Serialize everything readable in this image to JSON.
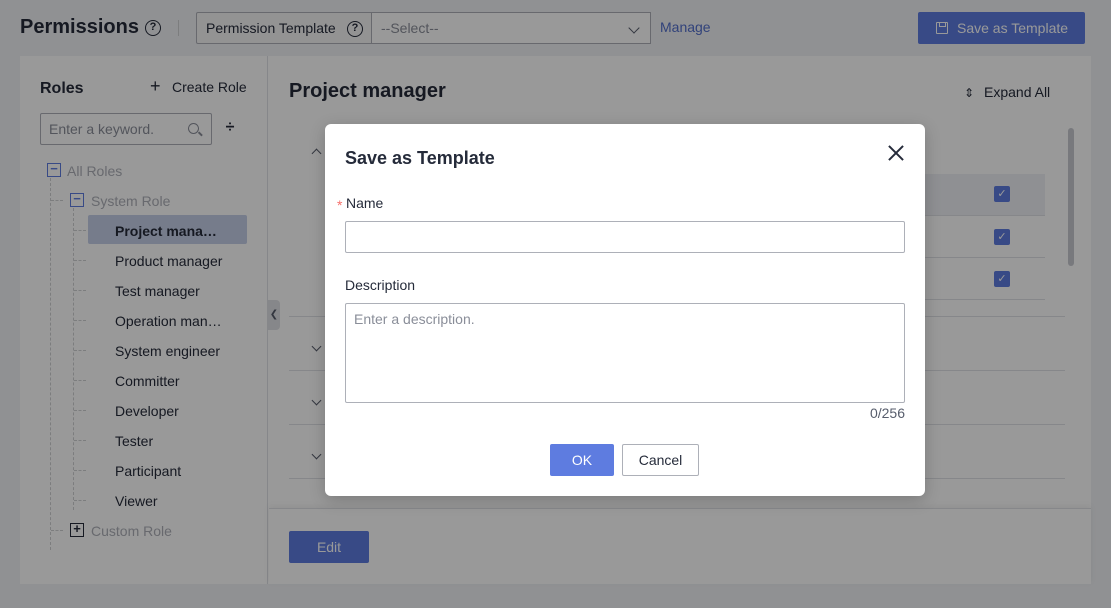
{
  "header": {
    "title": "Permissions",
    "template_label": "Permission Template",
    "template_select": "--Select--",
    "manage_link": "Manage",
    "save_template_button": "Save as Template"
  },
  "sidebar": {
    "title": "Roles",
    "create_role": "Create Role",
    "search_placeholder": "Enter a keyword.",
    "tree": {
      "all_roles": "All Roles",
      "system_role": "System Role",
      "custom_role": "Custom Role",
      "items": [
        {
          "label": "Project mana…",
          "active": true
        },
        {
          "label": "Product manager"
        },
        {
          "label": "Test manager"
        },
        {
          "label": "Operation man…"
        },
        {
          "label": "System engineer"
        },
        {
          "label": "Committer"
        },
        {
          "label": "Developer"
        },
        {
          "label": "Tester"
        },
        {
          "label": "Participant"
        },
        {
          "label": "Viewer"
        }
      ]
    }
  },
  "main": {
    "title": "Project manager",
    "expand_all": "Expand All",
    "edit_button": "Edit"
  },
  "dialog": {
    "title": "Save as Template",
    "name_label": "Name",
    "name_value": "",
    "description_label": "Description",
    "description_placeholder": "Enter a description.",
    "counter": "0/256",
    "ok_button": "OK",
    "cancel_button": "Cancel"
  },
  "colors": {
    "primary": "#5e7ce0",
    "link": "#526ecc",
    "required": "#f66f6a"
  }
}
